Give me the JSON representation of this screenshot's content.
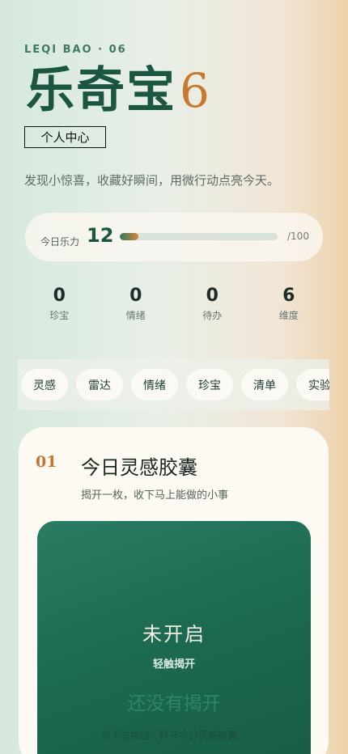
{
  "header": {
    "kicker": "LEQI BAO · 06",
    "title": "乐奇宝",
    "title_number": "6",
    "profile_button": "个人中心",
    "tagline": "发现小惊喜，收藏好瞬间，用微行动点亮今天。"
  },
  "energy": {
    "label": "今日乐力",
    "value": "12",
    "max": "/100",
    "progress_fraction": 0.12
  },
  "stats": [
    {
      "value": "0",
      "label": "珍宝"
    },
    {
      "value": "0",
      "label": "情绪"
    },
    {
      "value": "0",
      "label": "待办"
    },
    {
      "value": "6",
      "label": "维度"
    }
  ],
  "tabs": [
    "灵感",
    "雷达",
    "情绪",
    "珍宝",
    "清单",
    "实验"
  ],
  "card": {
    "index": "01",
    "title": "今日灵感胶囊",
    "subtitle": "揭开一枚，收下马上能做的小事",
    "capsule_state": "未开启",
    "capsule_hint": "轻触揭开",
    "capsule_empty_title": "还没有揭开",
    "capsule_empty_note": "点下方按钮，打开今日灵感胶囊。"
  },
  "colors": {
    "brand_green": "#1b5640",
    "accent_orange": "#c9792f",
    "capsule_green": "#1d6a52"
  }
}
